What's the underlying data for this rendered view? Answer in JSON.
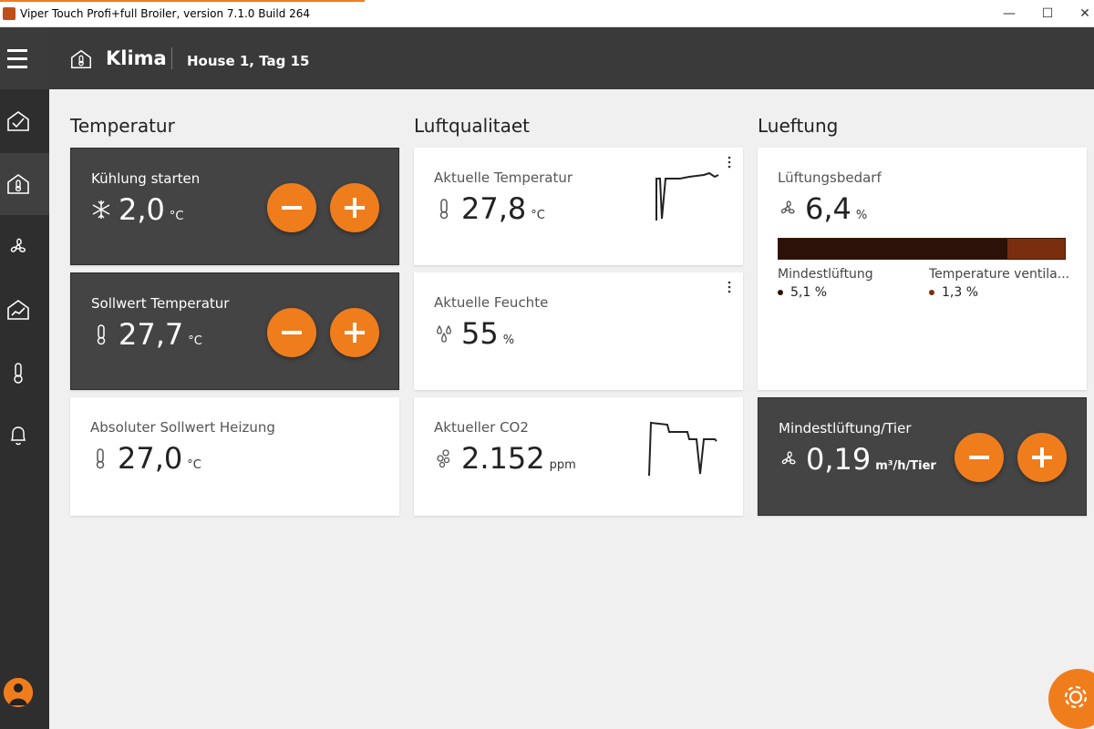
{
  "window": {
    "title": "Viper Touch Profi+full Broiler, version 7.1.0 Build 264",
    "minimize": "—",
    "maximize": "☐",
    "close": "✕"
  },
  "header": {
    "title": "Klima",
    "subtitle": "House 1, Tag 15"
  },
  "sidebar": {
    "items": [
      {
        "icon": "dashboard-check-icon"
      },
      {
        "icon": "house-thermometer-icon",
        "active": true
      },
      {
        "icon": "fan-icon"
      },
      {
        "icon": "graph-icon"
      },
      {
        "icon": "thermometer-icon"
      },
      {
        "icon": "bell-icon"
      }
    ]
  },
  "sections": {
    "temperatur": "Temperatur",
    "luftqualitaet": "Luftqualitaet",
    "lueftung": "Lueftung"
  },
  "temperatur": {
    "kuehlung": {
      "label": "Kühlung starten",
      "value": "2,0",
      "unit": "°C",
      "icon": "snowflake-icon"
    },
    "sollwert": {
      "label": "Sollwert Temperatur",
      "value": "27,7",
      "unit": "°C",
      "icon": "thermometer-icon"
    },
    "heizung": {
      "label": "Absoluter Sollwert Heizung",
      "value": "27,0",
      "unit": "°C",
      "icon": "thermometer-icon"
    }
  },
  "luftqualitaet": {
    "temperatur": {
      "label": "Aktuelle Temperatur",
      "value": "27,8",
      "unit": "°C",
      "icon": "thermometer-icon"
    },
    "feuchte": {
      "label": "Aktuelle Feuchte",
      "value": "55",
      "unit": "%",
      "icon": "droplets-icon"
    },
    "co2": {
      "label": "Aktueller CO2",
      "value": "2.152",
      "unit": "ppm",
      "icon": "bubbles-icon"
    }
  },
  "lueftung": {
    "bedarf": {
      "label": "Lüftungsbedarf",
      "value": "6,4",
      "unit": "%",
      "bar_fraction": 0.8,
      "legend": [
        {
          "label": "Mindestlüftung",
          "value": "5,1 %",
          "color": "#2a1208"
        },
        {
          "label": "Temperature ventila...",
          "value": "1,3 %",
          "color": "#7a2e10"
        }
      ]
    },
    "mindest_tier": {
      "label": "Mindestlüftung/Tier",
      "value": "0,19",
      "unit": "m³/h/Tier"
    }
  },
  "colors": {
    "accent": "#f07d1c",
    "dark_card": "#444444",
    "header": "#3a3a3a",
    "sidebar": "#2e2e2e"
  }
}
